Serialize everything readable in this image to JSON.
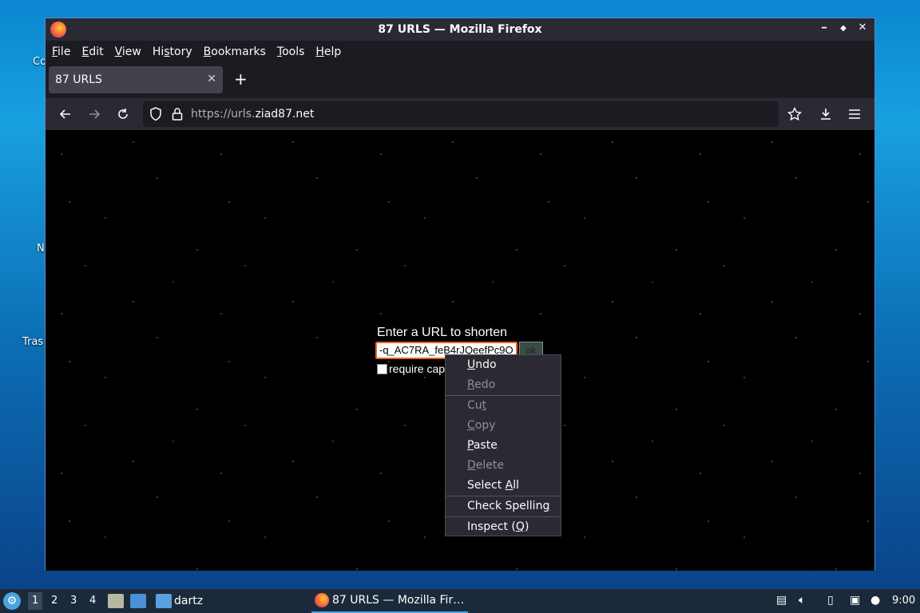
{
  "desktop": {
    "icon_labels": [
      "Co",
      "N",
      "Tras"
    ]
  },
  "window": {
    "title": "87 URLS — Mozilla Firefox",
    "controls": {
      "minimize": "━",
      "maximize": "◆",
      "close": "✕"
    }
  },
  "menubar": {
    "items": [
      "File",
      "Edit",
      "View",
      "History",
      "Bookmarks",
      "Tools",
      "Help"
    ]
  },
  "tabs": [
    {
      "label": "87 URLS",
      "active": true
    }
  ],
  "new_tab_label": "+",
  "navbar": {
    "url_prefix": "https://urls.",
    "url_host": "ziad87.net",
    "icons": [
      "back-icon",
      "forward-icon",
      "reload-icon",
      "shield-icon",
      "lock-icon",
      "star-icon",
      "download-icon",
      "menu-icon"
    ]
  },
  "page": {
    "label": "Enter a URL to shorten",
    "input_value": "-q_AC7RA_feB4rJQeefPc9O",
    "ok_label": "ok",
    "captcha_label": "require captcha",
    "accent_color": "#e8621b"
  },
  "context_menu": {
    "items": [
      {
        "label": "Undo",
        "key": "U",
        "rest": "ndo",
        "enabled": true
      },
      {
        "label": "Redo",
        "key": "R",
        "rest": "edo",
        "enabled": false
      },
      {
        "label": "Cut",
        "pre": "Cu",
        "key": "t",
        "enabled": false
      },
      {
        "label": "Copy",
        "key": "C",
        "rest": "opy",
        "enabled": false
      },
      {
        "label": "Paste",
        "key": "P",
        "rest": "aste",
        "enabled": true
      },
      {
        "label": "Delete",
        "key": "D",
        "rest": "elete",
        "enabled": false
      },
      {
        "label": "Select All",
        "pre": "Select ",
        "key": "A",
        "rest": "ll",
        "enabled": true
      },
      {
        "label": "Check Spelling",
        "pre": "Check Spellin",
        "key": "g",
        "enabled": true
      },
      {
        "label": "Inspect (Q)",
        "pre": "Inspect (",
        "key": "Q",
        "rest": ")",
        "enabled": true
      }
    ]
  },
  "taskbar": {
    "workspaces": [
      "1",
      "2",
      "3",
      "4"
    ],
    "folder_label": "dartz",
    "task_label": "87 URLS — Mozilla Fir…",
    "clock": "9:00"
  }
}
